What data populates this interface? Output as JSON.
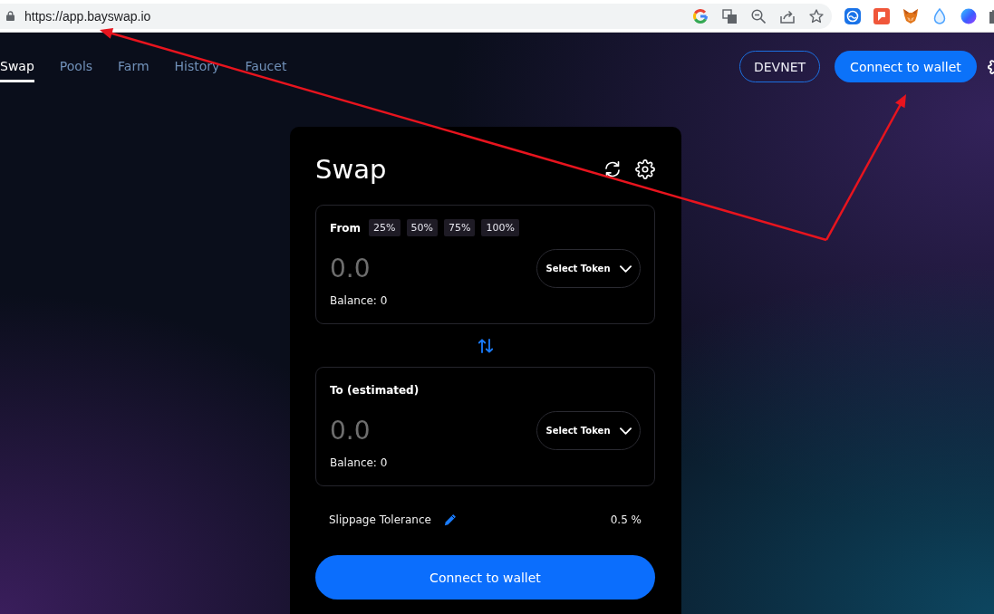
{
  "browser": {
    "url": "https://app.bayswap.io"
  },
  "nav": {
    "tabs": [
      {
        "label": "Swap",
        "selected": true
      },
      {
        "label": "Pools",
        "selected": false
      },
      {
        "label": "Farm",
        "selected": false
      },
      {
        "label": "History",
        "selected": false
      },
      {
        "label": "Faucet",
        "selected": false
      }
    ],
    "network_button": "DEVNET",
    "connect_button": "Connect to wallet"
  },
  "swap_card": {
    "title": "Swap",
    "panels": [
      {
        "label": "From",
        "percent_buttons": [
          "25%",
          "50%",
          "75%",
          "100%"
        ],
        "amount": {
          "placeholder": "0.0"
        },
        "token_button": "Select Token",
        "balance": "Balance: 0"
      },
      {
        "label": "To (estimated)",
        "amount": {
          "placeholder": "0.0"
        },
        "token_button": "Select Token",
        "balance": "Balance: 0"
      }
    ],
    "slippage": {
      "label": "Slippage Tolerance",
      "value": "0.5 %"
    },
    "connect_button": "Connect to wallet"
  }
}
